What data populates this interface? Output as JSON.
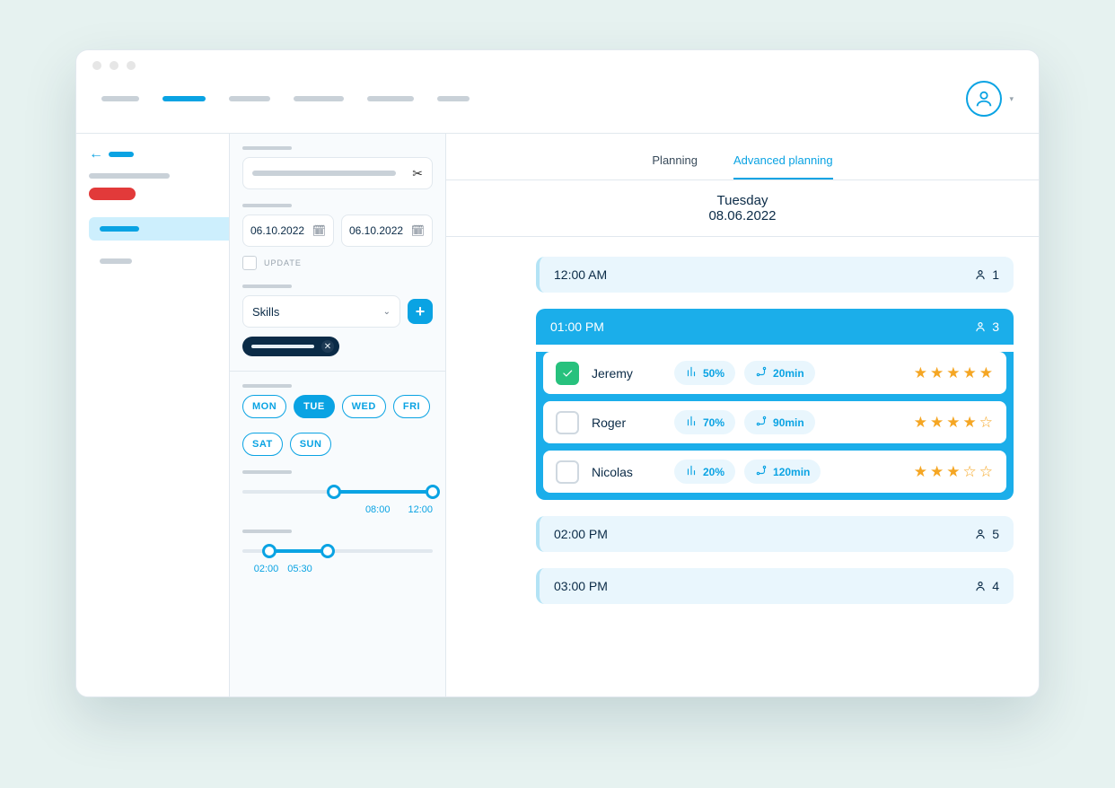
{
  "colors": {
    "blue": "#0aa3e3",
    "green": "#27c17d",
    "gold": "#f5a623",
    "red": "#e23a3a"
  },
  "topbar": {
    "nav_count": 6,
    "active_index": 1
  },
  "tabs": {
    "planning": "Planning",
    "advanced": "Advanced planning",
    "active": "advanced"
  },
  "header": {
    "day": "Tuesday",
    "date": "08.06.2022"
  },
  "filters": {
    "date_from": "06.10.2022",
    "date_to": "06.10.2022",
    "update_label": "UPDATE",
    "select": {
      "label": "Skills"
    },
    "days": {
      "options": [
        "MON",
        "TUE",
        "WED",
        "FRI",
        "SAT",
        "SUN"
      ],
      "active": "TUE"
    },
    "range1": {
      "from": "08:00",
      "to": "12:00",
      "from_pct": 48,
      "to_pct": 100
    },
    "range2": {
      "from": "02:00",
      "to": "05:30",
      "from_pct": 14,
      "to_pct": 45
    }
  },
  "slots": [
    {
      "time": "12:00 AM",
      "count": 1,
      "active": false
    },
    {
      "time": "01:00 PM",
      "count": 3,
      "active": true,
      "people": [
        {
          "name": "Jeremy",
          "checked": true,
          "percent": "50%",
          "duration": "20min",
          "stars": 5
        },
        {
          "name": "Roger",
          "checked": false,
          "percent": "70%",
          "duration": "90min",
          "stars": 4
        },
        {
          "name": "Nicolas",
          "checked": false,
          "percent": "20%",
          "duration": "120min",
          "stars": 3
        }
      ]
    },
    {
      "time": "02:00 PM",
      "count": 5,
      "active": false
    },
    {
      "time": "03:00 PM",
      "count": 4,
      "active": false
    }
  ]
}
